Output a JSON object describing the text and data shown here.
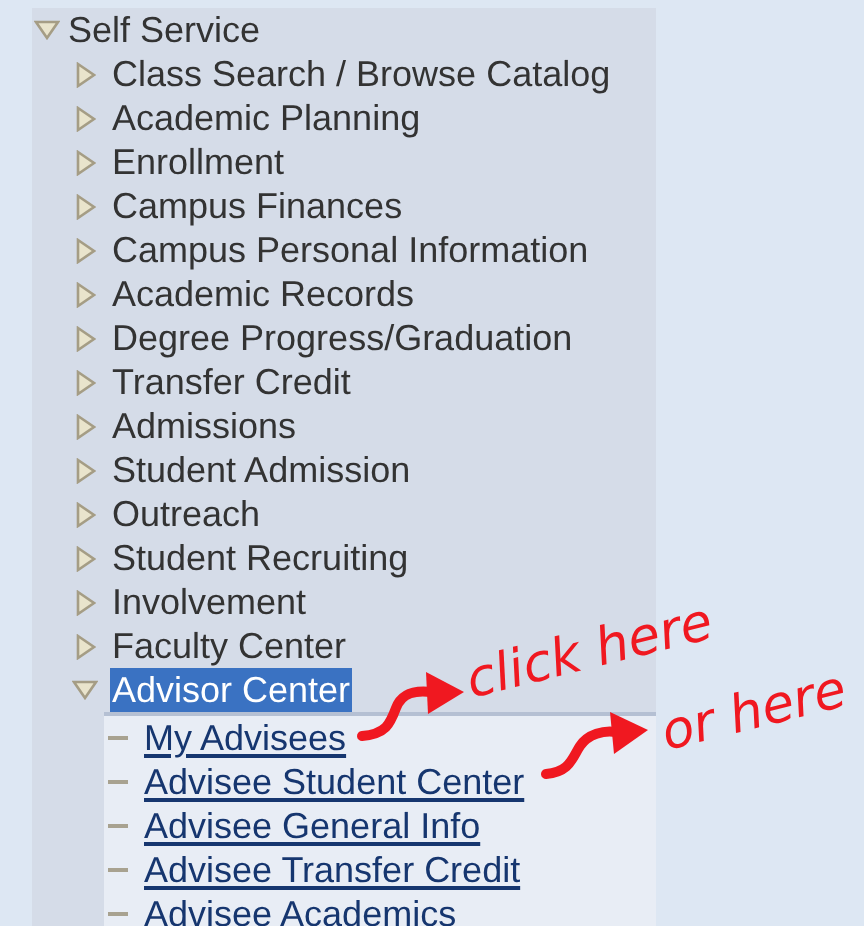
{
  "tree": {
    "label": "Self Service",
    "expanded": true,
    "children": [
      {
        "kind": "folder",
        "label": "Class Search / Browse Catalog",
        "expanded": false,
        "selected": false
      },
      {
        "kind": "folder",
        "label": "Academic Planning",
        "expanded": false,
        "selected": false
      },
      {
        "kind": "folder",
        "label": "Enrollment",
        "expanded": false,
        "selected": false
      },
      {
        "kind": "folder",
        "label": "Campus Finances",
        "expanded": false,
        "selected": false
      },
      {
        "kind": "folder",
        "label": "Campus Personal Information",
        "expanded": false,
        "selected": false
      },
      {
        "kind": "folder",
        "label": "Academic Records",
        "expanded": false,
        "selected": false
      },
      {
        "kind": "folder",
        "label": "Degree Progress/Graduation",
        "expanded": false,
        "selected": false
      },
      {
        "kind": "folder",
        "label": "Transfer Credit",
        "expanded": false,
        "selected": false
      },
      {
        "kind": "folder",
        "label": "Admissions",
        "expanded": false,
        "selected": false
      },
      {
        "kind": "folder",
        "label": "Student Admission",
        "expanded": false,
        "selected": false
      },
      {
        "kind": "folder",
        "label": "Outreach",
        "expanded": false,
        "selected": false
      },
      {
        "kind": "folder",
        "label": "Student Recruiting",
        "expanded": false,
        "selected": false
      },
      {
        "kind": "folder",
        "label": "Involvement",
        "expanded": false,
        "selected": false
      },
      {
        "kind": "folder",
        "label": "Faculty Center",
        "expanded": false,
        "selected": false
      },
      {
        "kind": "folder",
        "label": "Advisor Center",
        "expanded": true,
        "selected": true,
        "children": [
          {
            "kind": "link",
            "label": "My Advisees"
          },
          {
            "kind": "link",
            "label": "Advisee Student Center"
          },
          {
            "kind": "link",
            "label": "Advisee General Info"
          },
          {
            "kind": "link",
            "label": "Advisee Transfer Credit"
          },
          {
            "kind": "link",
            "label": "Advisee Academics"
          }
        ]
      }
    ]
  },
  "annotations": [
    {
      "text": "click here"
    },
    {
      "text": "or here"
    }
  ]
}
